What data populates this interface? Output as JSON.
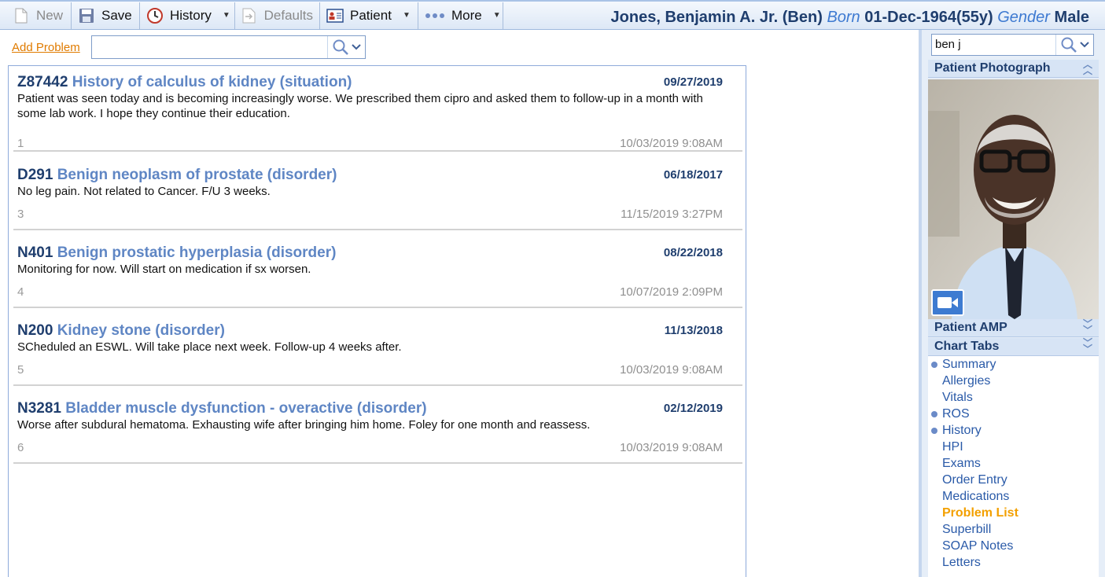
{
  "toolbar": {
    "new_label": "New",
    "save_label": "Save",
    "history_label": "History",
    "defaults_label": "Defaults",
    "patient_label": "Patient",
    "more_label": "More"
  },
  "patient": {
    "name": "Jones, Benjamin A. Jr. (Ben)",
    "born_label": "Born",
    "born_value": "01-Dec-1964(55y)",
    "gender_label": "Gender",
    "gender_value": "Male"
  },
  "main": {
    "add_problem_label": "Add Problem",
    "search_value": ""
  },
  "problems": [
    {
      "code": "Z87442",
      "name": "History of calculus of kidney (situation)",
      "date": "09/27/2019",
      "note": "Patient was seen today and is becoming increasingly worse. We prescribed them cipro and asked them to follow-up in a month with some lab work. I hope they continue their education.",
      "num": "1",
      "stamp": "10/03/2019 9:08AM"
    },
    {
      "code": "D291",
      "name": "Benign neoplasm of prostate (disorder)",
      "date": "06/18/2017",
      "note": "No leg pain. Not related to Cancer. F/U 3 weeks.",
      "num": "3",
      "stamp": "11/15/2019 3:27PM"
    },
    {
      "code": "N401",
      "name": "Benign prostatic hyperplasia (disorder)",
      "date": "08/22/2018",
      "note": "Monitoring for now. Will start on medication if sx worsen.",
      "num": "4",
      "stamp": "10/07/2019 2:09PM"
    },
    {
      "code": "N200",
      "name": "Kidney stone (disorder)",
      "date": "11/13/2018",
      "note": "SCheduled an ESWL. Will take place next week. Follow-up 4 weeks after.",
      "num": "5",
      "stamp": "10/03/2019 9:08AM"
    },
    {
      "code": "N3281",
      "name": "Bladder muscle dysfunction - overactive (disorder)",
      "date": "02/12/2019",
      "note": "Worse after subdural hematoma. Exhausting wife after bringing him home. Foley for one month and reassess.",
      "num": "6",
      "stamp": "10/03/2019 9:08AM"
    }
  ],
  "sidebar": {
    "search_value": "ben j",
    "photo_title": "Patient Photograph",
    "amp_title": "Patient AMP",
    "tabs_title": "Chart Tabs",
    "tabs": [
      {
        "label": "Summary",
        "dot": true
      },
      {
        "label": "Allergies",
        "dot": false
      },
      {
        "label": "Vitals",
        "dot": false
      },
      {
        "label": "ROS",
        "dot": true
      },
      {
        "label": "History",
        "dot": true
      },
      {
        "label": "HPI",
        "dot": false
      },
      {
        "label": "Exams",
        "dot": false
      },
      {
        "label": "Order Entry",
        "dot": false
      },
      {
        "label": "Medications",
        "dot": false
      },
      {
        "label": "Problem List",
        "dot": false,
        "active": true
      },
      {
        "label": "Superbill",
        "dot": false
      },
      {
        "label": "SOAP Notes",
        "dot": false
      },
      {
        "label": "Letters",
        "dot": false
      }
    ]
  },
  "colors": {
    "accent": "#1f3e6e",
    "link_orange": "#e07b00",
    "active_tab": "#f3a000",
    "problem_name": "#5f86c4"
  }
}
